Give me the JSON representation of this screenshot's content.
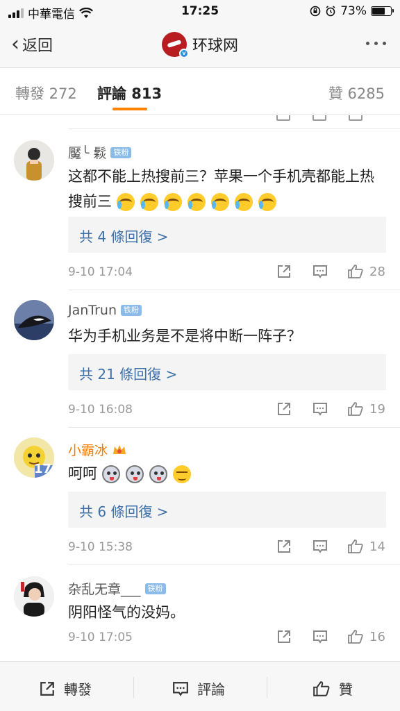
{
  "status_bar": {
    "carrier": "中華電信",
    "time": "17:25",
    "battery": "73%",
    "battery_level": 0.73
  },
  "nav": {
    "back_label": "返回",
    "title": "环球网"
  },
  "tabs": {
    "reposts": "轉發 272",
    "comments": "評論 813",
    "likes": "贊 6285"
  },
  "comments": [
    {
      "name": "魘╰ 鬏",
      "badge": "铁粉",
      "text": "这都不能上热搜前三？苹果一个手机壳都能上热搜前三",
      "emojis": [
        "cry",
        "cry",
        "cry",
        "cry",
        "cry",
        "cry",
        "cry"
      ],
      "replies": "共 4 條回復 >",
      "time": "9-10 17:04",
      "likes": "28"
    },
    {
      "name": "JanTrun",
      "badge": "铁粉",
      "text": "华为手机业务是不是将中断一阵子？",
      "replies": "共 21 條回復 >",
      "time": "9-10 16:08",
      "likes": "19"
    },
    {
      "name": "小霸冰",
      "text": "呵呵",
      "emojis": [
        "dog",
        "dog",
        "dog",
        "smug"
      ],
      "replies": "共 6 條回復 >",
      "time": "9-10 15:38",
      "likes": "14",
      "avatar_number": "17"
    },
    {
      "name": "杂乱无章___",
      "badge": "铁粉",
      "text": "阴阳怪气的没妈。",
      "time": "9-10 17:05",
      "likes": "16"
    }
  ],
  "bottom_bar": {
    "repost": "轉發",
    "comment": "評論",
    "like": "贊"
  },
  "colors": {
    "accent": "#ff8200",
    "link": "#3d6fa8",
    "vip_name": "#f57c00"
  }
}
